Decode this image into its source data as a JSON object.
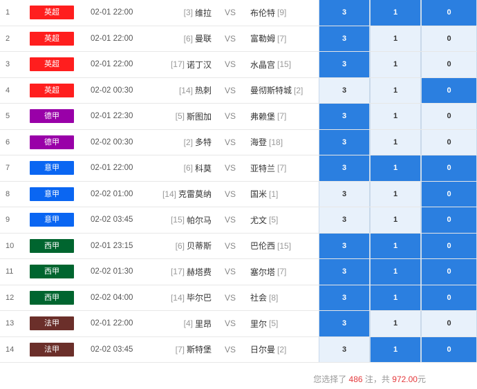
{
  "matches": [
    {
      "num": "1",
      "league": "英超",
      "color": "#ff1e1e",
      "time": "02-01 22:00",
      "home_rank": "[3]",
      "home": "维拉",
      "vs": "VS",
      "away": "布伦特",
      "away_rank": "[9]",
      "odds": [
        "3",
        "1",
        "0"
      ],
      "selected": [
        true,
        true,
        true
      ]
    },
    {
      "num": "2",
      "league": "英超",
      "color": "#ff1e1e",
      "time": "02-01 22:00",
      "home_rank": "[6]",
      "home": "曼联",
      "vs": "VS",
      "away": "富勒姆",
      "away_rank": "[7]",
      "odds": [
        "3",
        "1",
        "0"
      ],
      "selected": [
        true,
        false,
        false
      ]
    },
    {
      "num": "3",
      "league": "英超",
      "color": "#ff1e1e",
      "time": "02-01 22:00",
      "home_rank": "[17]",
      "home": "诺丁汉",
      "vs": "VS",
      "away": "水晶宫",
      "away_rank": "[15]",
      "odds": [
        "3",
        "1",
        "0"
      ],
      "selected": [
        true,
        false,
        false
      ]
    },
    {
      "num": "4",
      "league": "英超",
      "color": "#ff1e1e",
      "time": "02-02 00:30",
      "home_rank": "[14]",
      "home": "热刺",
      "vs": "VS",
      "away": "曼彻斯特城",
      "away_rank": "[2]",
      "odds": [
        "3",
        "1",
        "0"
      ],
      "selected": [
        false,
        false,
        true
      ]
    },
    {
      "num": "5",
      "league": "德甲",
      "color": "#9900a8",
      "time": "02-01 22:30",
      "home_rank": "[5]",
      "home": "斯图加",
      "vs": "VS",
      "away": "弗赖堡",
      "away_rank": "[7]",
      "odds": [
        "3",
        "1",
        "0"
      ],
      "selected": [
        true,
        false,
        false
      ]
    },
    {
      "num": "6",
      "league": "德甲",
      "color": "#9900a8",
      "time": "02-02 00:30",
      "home_rank": "[2]",
      "home": "多特",
      "vs": "VS",
      "away": "海登",
      "away_rank": "[18]",
      "odds": [
        "3",
        "1",
        "0"
      ],
      "selected": [
        true,
        false,
        false
      ]
    },
    {
      "num": "7",
      "league": "意甲",
      "color": "#0a66f2",
      "time": "02-01 22:00",
      "home_rank": "[6]",
      "home": "科莫",
      "vs": "VS",
      "away": "亚特兰",
      "away_rank": "[7]",
      "odds": [
        "3",
        "1",
        "0"
      ],
      "selected": [
        true,
        true,
        true
      ]
    },
    {
      "num": "8",
      "league": "意甲",
      "color": "#0a66f2",
      "time": "02-02 01:00",
      "home_rank": "[14]",
      "home": "克雷莫纳",
      "vs": "VS",
      "away": "国米",
      "away_rank": "[1]",
      "odds": [
        "3",
        "1",
        "0"
      ],
      "selected": [
        false,
        false,
        true
      ]
    },
    {
      "num": "9",
      "league": "意甲",
      "color": "#0a66f2",
      "time": "02-02 03:45",
      "home_rank": "[15]",
      "home": "帕尔马",
      "vs": "VS",
      "away": "尤文",
      "away_rank": "[5]",
      "odds": [
        "3",
        "1",
        "0"
      ],
      "selected": [
        false,
        false,
        true
      ]
    },
    {
      "num": "10",
      "league": "西甲",
      "color": "#00652f",
      "time": "02-01 23:15",
      "home_rank": "[6]",
      "home": "贝蒂斯",
      "vs": "VS",
      "away": "巴伦西",
      "away_rank": "[15]",
      "odds": [
        "3",
        "1",
        "0"
      ],
      "selected": [
        true,
        true,
        true
      ]
    },
    {
      "num": "11",
      "league": "西甲",
      "color": "#00652f",
      "time": "02-02 01:30",
      "home_rank": "[17]",
      "home": "赫塔费",
      "vs": "VS",
      "away": "塞尔塔",
      "away_rank": "[7]",
      "odds": [
        "3",
        "1",
        "0"
      ],
      "selected": [
        true,
        true,
        true
      ]
    },
    {
      "num": "12",
      "league": "西甲",
      "color": "#00652f",
      "time": "02-02 04:00",
      "home_rank": "[14]",
      "home": "毕尔巴",
      "vs": "VS",
      "away": "社会",
      "away_rank": "[8]",
      "odds": [
        "3",
        "1",
        "0"
      ],
      "selected": [
        true,
        true,
        true
      ]
    },
    {
      "num": "13",
      "league": "法甲",
      "color": "#6b2f2a",
      "time": "02-01 22:00",
      "home_rank": "[4]",
      "home": "里昂",
      "vs": "VS",
      "away": "里尔",
      "away_rank": "[5]",
      "odds": [
        "3",
        "1",
        "0"
      ],
      "selected": [
        true,
        false,
        false
      ]
    },
    {
      "num": "14",
      "league": "法甲",
      "color": "#6b2f2a",
      "time": "02-02 03:45",
      "home_rank": "[7]",
      "home": "斯特堡",
      "vs": "VS",
      "away": "日尔曼",
      "away_rank": "[2]",
      "odds": [
        "3",
        "1",
        "0"
      ],
      "selected": [
        false,
        true,
        true
      ]
    }
  ],
  "footer": {
    "prefix": "您选择了",
    "count": "486",
    "mid": "注，共",
    "amount": "972.00",
    "suffix": "元"
  },
  "colors": {
    "selected": "#2b7fe0",
    "unselected": "#e8f1fb",
    "highlight": "#e4393c"
  }
}
